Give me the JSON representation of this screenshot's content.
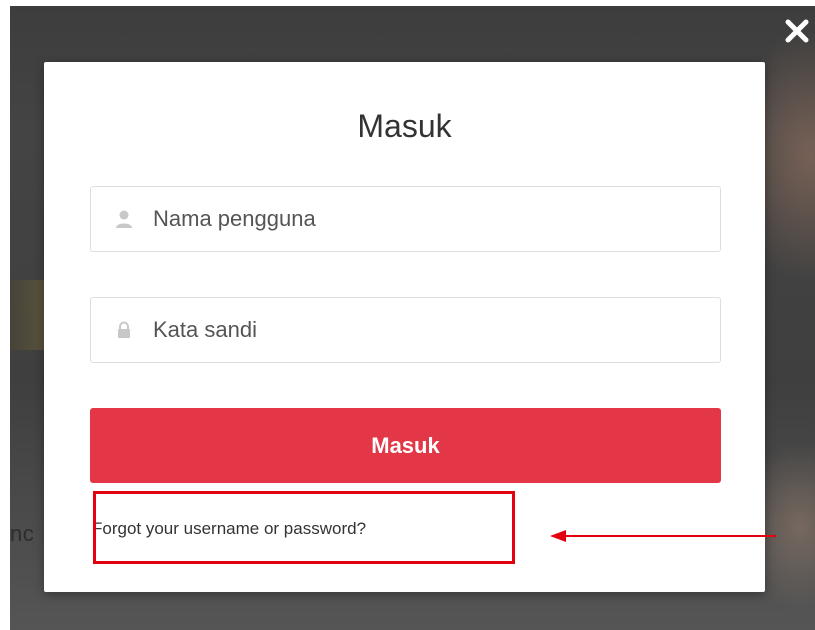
{
  "background": {
    "partial_text": "nc"
  },
  "close_icon": "close-icon",
  "modal": {
    "title": "Masuk",
    "username": {
      "placeholder": "Nama pengguna",
      "value": "",
      "icon": "user-icon"
    },
    "password": {
      "placeholder": "Kata sandi",
      "value": "",
      "icon": "lock-icon"
    },
    "submit_label": "Masuk",
    "forgot_link": "Forgot your username or password?"
  },
  "colors": {
    "accent": "#e33646",
    "annotation": "#e3000f",
    "overlay": "#3f3f3f"
  }
}
